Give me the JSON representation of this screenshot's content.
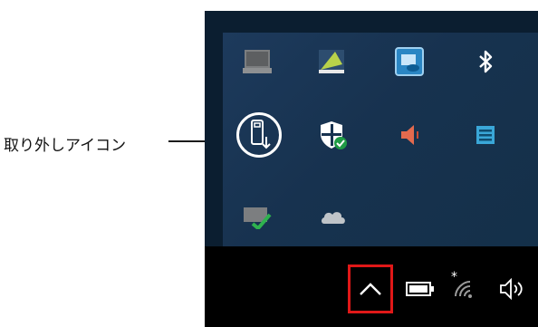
{
  "callout": {
    "label": "取り外しアイコン"
  },
  "flyout": {
    "icons": [
      {
        "name": "network-computer-icon"
      },
      {
        "name": "display-settings-icon"
      },
      {
        "name": "intel-graphics-icon"
      },
      {
        "name": "bluetooth-icon"
      },
      {
        "name": "usb-safely-remove-icon",
        "highlighted": true
      },
      {
        "name": "windows-security-icon"
      },
      {
        "name": "speaker-muted-icon"
      },
      {
        "name": "app-notes-icon"
      },
      {
        "name": "sync-check-icon"
      },
      {
        "name": "onedrive-cloud-icon"
      }
    ]
  },
  "taskbar": {
    "icons": [
      "show-hidden-icons-chevron-icon",
      "battery-icon",
      "wifi-icon",
      "volume-icon"
    ]
  },
  "colors": {
    "highlight_box": "#e01818",
    "highlight_ring": "#ffffff",
    "flyout_bg": "#17324f",
    "taskbar_bg": "#000000"
  }
}
